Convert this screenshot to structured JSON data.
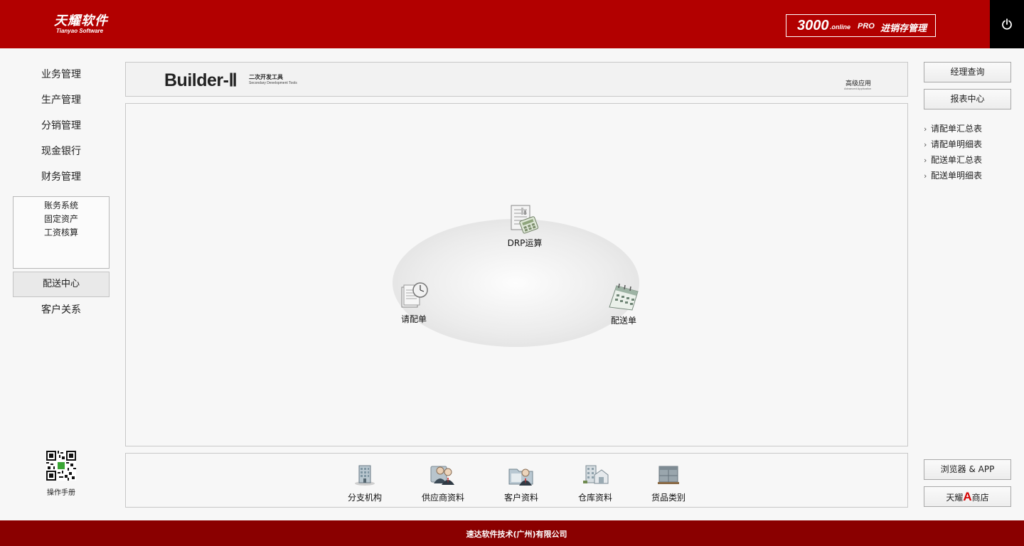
{
  "header": {
    "logo_cn": "天耀软件",
    "logo_en": "Tianyao Software",
    "product_number": "3000",
    "product_online": ".online",
    "product_pro": "PRO",
    "product_name": "进销存管理",
    "power_icon": "power-icon"
  },
  "left_nav": {
    "items": [
      "业务管理",
      "生产管理",
      "分销管理",
      "现金银行",
      "财务管理"
    ],
    "sub_items": [
      "账务系统",
      "固定资产",
      "工资核算"
    ],
    "active_item": "配送中心",
    "after_item": "客户关系",
    "qr_label": "操作手册"
  },
  "builder": {
    "title": "Builder-Ⅱ",
    "cn": "二次开发工具",
    "en": "Secondary Development Tools",
    "adv_cn": "高级应用",
    "adv_en": "Advanced Application"
  },
  "flow": {
    "nodes": [
      {
        "label": "DRP运算",
        "icon": "calculator-report-icon"
      },
      {
        "label": "请配单",
        "icon": "document-clock-icon"
      },
      {
        "label": "配送单",
        "icon": "calendar-icon"
      }
    ]
  },
  "bottom": {
    "items": [
      {
        "label": "分支机构",
        "icon": "branch-building-icon"
      },
      {
        "label": "供应商资料",
        "icon": "supplier-people-icon"
      },
      {
        "label": "客户资料",
        "icon": "customer-folder-icon"
      },
      {
        "label": "仓库资料",
        "icon": "warehouse-icon"
      },
      {
        "label": "货品类别",
        "icon": "goods-boxes-icon"
      }
    ]
  },
  "right": {
    "manager_query": "经理查询",
    "report_center": "报表中心",
    "reports": [
      "请配单汇总表",
      "请配单明细表",
      "配送单汇总表",
      "配送单明细表"
    ],
    "browser_app": "浏览器 & APP",
    "store_prefix": "天耀",
    "store_a": "A",
    "store_suffix": "商店"
  },
  "footer": {
    "text": "速达软件技术(广州)有限公司"
  },
  "colors": {
    "header_red": "#b20000",
    "footer_red": "#8a0000",
    "power_black": "#000000"
  }
}
